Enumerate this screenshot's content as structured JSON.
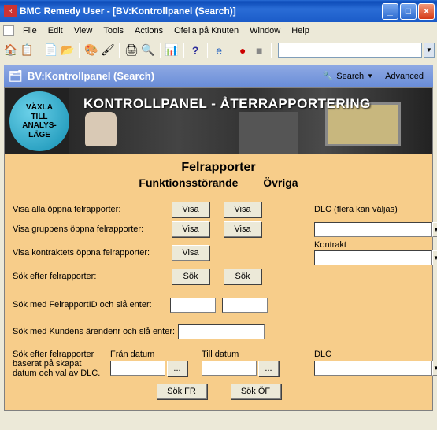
{
  "window": {
    "title": "BMC Remedy User - [BV:Kontrollpanel (Search)]"
  },
  "menu": {
    "file": "File",
    "edit": "Edit",
    "view": "View",
    "tools": "Tools",
    "actions": "Actions",
    "ofelia": "Ofelia på Knuten",
    "window": "Window",
    "help": "Help"
  },
  "toolbar": {
    "combo_value": ""
  },
  "blueband": {
    "title": "BV:Kontrollpanel (Search)",
    "search": "Search",
    "advanced": "Advanced"
  },
  "circle": {
    "line1": "VÄXLA",
    "line2": "TILL",
    "line3": "ANALYS-",
    "line4": "LÄGE"
  },
  "banner": {
    "title": "KONTROLLPANEL - ÅTERRAPPORTERING"
  },
  "headings": {
    "h1": "Felrapporter",
    "h2a": "Funktionsstörande",
    "h2b": "Övriga"
  },
  "rows": {
    "alla": "Visa alla öppna felrapporter:",
    "grupp": "Visa gruppens öppna felrapporter:",
    "kontrakt": "Visa kontraktets öppna felrapporter:",
    "sok": "Sök efter felrapporter:",
    "fid": "Sök med FelrapportID och slå enter:",
    "kund": "Sök med Kundens ärendenr och slå enter:",
    "range": "Sök efter felrapporter baserat på skapat datum och val av DLC.",
    "fran": "Från datum",
    "till": "Till datum",
    "dlc2": "DLC"
  },
  "buttons": {
    "visa": "Visa",
    "sok": "Sök",
    "dots": "...",
    "sokfr": "Sök FR",
    "sokof": "Sök ÖF"
  },
  "right": {
    "dlc": "DLC (flera kan väljas)",
    "kontrakt": "Kontrakt"
  },
  "inputs": {
    "fid1": "",
    "fid2": "",
    "kund": "",
    "fran": "",
    "till": "",
    "dlc_top": "",
    "kontrakt": "",
    "dlc_bottom": ""
  }
}
